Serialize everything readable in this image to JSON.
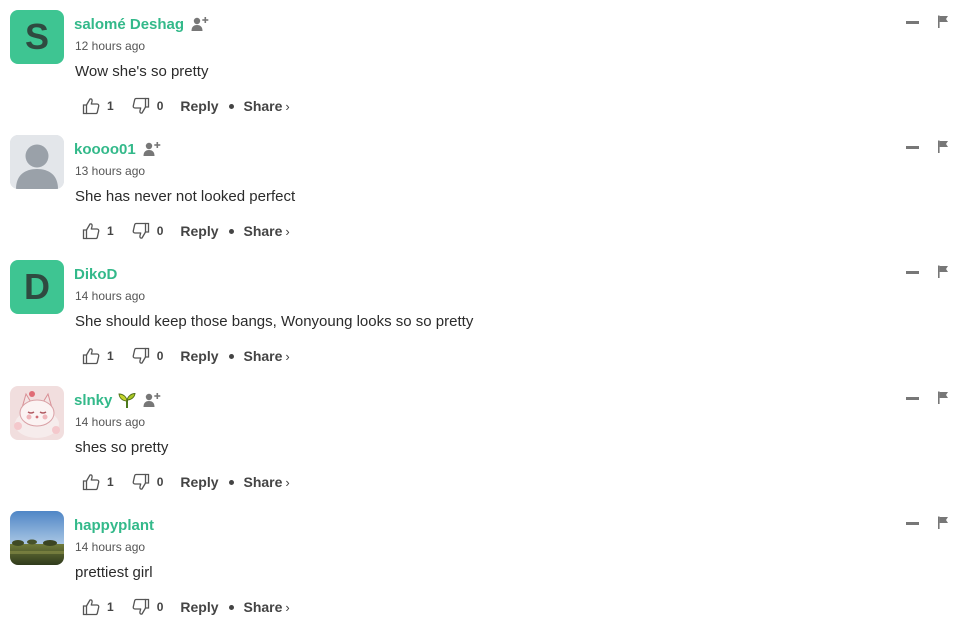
{
  "comments": [
    {
      "username": "salomé Deshag",
      "avatar_letter": "S",
      "avatar_type": "letter",
      "has_follow": true,
      "has_badge": false,
      "time": "12 hours ago",
      "text": "Wow she's so pretty",
      "likes": "1",
      "dislikes": "0"
    },
    {
      "username": "koooo01",
      "avatar_type": "default-person",
      "has_follow": true,
      "has_badge": false,
      "time": "13 hours ago",
      "text": "She has never not looked perfect",
      "likes": "1",
      "dislikes": "0"
    },
    {
      "username": "DikoD",
      "avatar_letter": "D",
      "avatar_type": "letter",
      "has_follow": false,
      "has_badge": false,
      "time": "14 hours ago",
      "text": "She should keep those bangs, Wonyoung looks so so pretty",
      "likes": "1",
      "dislikes": "0"
    },
    {
      "username": "slnky",
      "avatar_type": "cartoon-cat",
      "has_follow": true,
      "has_badge": true,
      "time": "14 hours ago",
      "text": "shes so pretty",
      "likes": "1",
      "dislikes": "0"
    },
    {
      "username": "happyplant",
      "avatar_type": "landscape-photo",
      "has_follow": false,
      "has_badge": false,
      "time": "14 hours ago",
      "text": "prettiest girl",
      "likes": "1",
      "dislikes": "0"
    }
  ],
  "labels": {
    "reply": "Reply",
    "share": "Share",
    "share_chevron": "›"
  },
  "colors": {
    "username": "#33b98a",
    "letter_avatar_bg": "#3ec592",
    "letter_avatar_fg": "#2f4a40",
    "text": "#2b2b2b",
    "icon": "#777777"
  },
  "icons": {
    "like": "thumbs-up-icon",
    "dislike": "thumbs-down-icon",
    "follow": "add-user-icon",
    "collapse": "minus-icon",
    "report": "flag-icon",
    "badge": "sprout-icon"
  }
}
